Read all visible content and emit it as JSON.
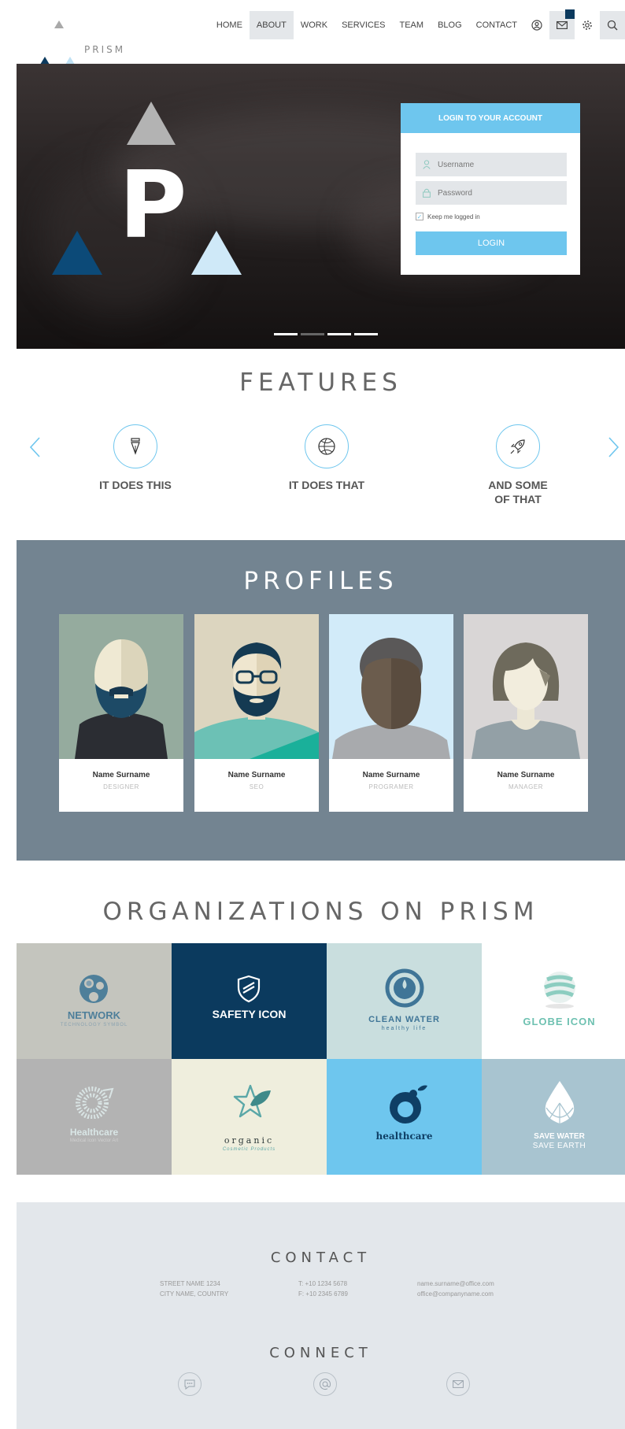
{
  "brand": {
    "name": "PRISM"
  },
  "nav": {
    "items": [
      {
        "label": "HOME"
      },
      {
        "label": "ABOUT"
      },
      {
        "label": "WORK"
      },
      {
        "label": "SERVICES"
      },
      {
        "label": "TEAM"
      },
      {
        "label": "BLOG"
      },
      {
        "label": "CONTACT"
      }
    ],
    "active": "ABOUT",
    "icons": [
      "user-icon",
      "mail-icon",
      "gear-icon",
      "search-icon"
    ]
  },
  "hero": {
    "letter": "P",
    "slides": 4,
    "active_slide": 1
  },
  "login": {
    "title": "LOGIN TO YOUR ACCOUNT",
    "username_placeholder": "Username",
    "password_placeholder": "Password",
    "keep_logged_in": "Keep me logged in",
    "button": "LOGIN"
  },
  "features": {
    "title": "FEATURES",
    "items": [
      {
        "label": "IT DOES THIS",
        "icon": "pen-nib-icon"
      },
      {
        "label": "IT DOES THAT",
        "icon": "basketball-icon"
      },
      {
        "label": "AND SOME OF THAT",
        "icon": "rocket-icon"
      }
    ]
  },
  "profiles": {
    "title": "PROFILES",
    "people": [
      {
        "name": "Name Surname",
        "role": "DESIGNER"
      },
      {
        "name": "Name Surname",
        "role": "SEO"
      },
      {
        "name": "Name Surname",
        "role": "PROGRAMER"
      },
      {
        "name": "Name Surname",
        "role": "MANAGER"
      }
    ]
  },
  "organizations": {
    "title": "ORGANIZATIONS ON PRISM",
    "logos": [
      {
        "name": "NETWORK",
        "tagline": "TECHNOLOGY SYMBOL"
      },
      {
        "name": "SAFETY ICON",
        "tagline": ""
      },
      {
        "name": "CLEAN WATER",
        "tagline": "healthy life"
      },
      {
        "name": "GLOBE ICON",
        "tagline": ""
      },
      {
        "name": "Healthcare",
        "tagline": "Medical Icon Vector Art"
      },
      {
        "name": "organic",
        "tagline": "Cosmetic Products"
      },
      {
        "name": "healthcare",
        "tagline": ""
      },
      {
        "name": "SAVE WATER",
        "tagline": "SAVE EARTH"
      }
    ]
  },
  "contact": {
    "title": "CONTACT",
    "address": [
      "STREET NAME 1234",
      "CITY NAME, COUNTRY"
    ],
    "phones": [
      "T: +10 1234 5678",
      "F: +10 2345 6789"
    ],
    "emails": [
      "name.surname@office.com",
      "office@companyname.com"
    ]
  },
  "connect": {
    "title": "CONNECT",
    "icons": [
      "chat-icon",
      "at-icon",
      "mail-icon"
    ]
  }
}
